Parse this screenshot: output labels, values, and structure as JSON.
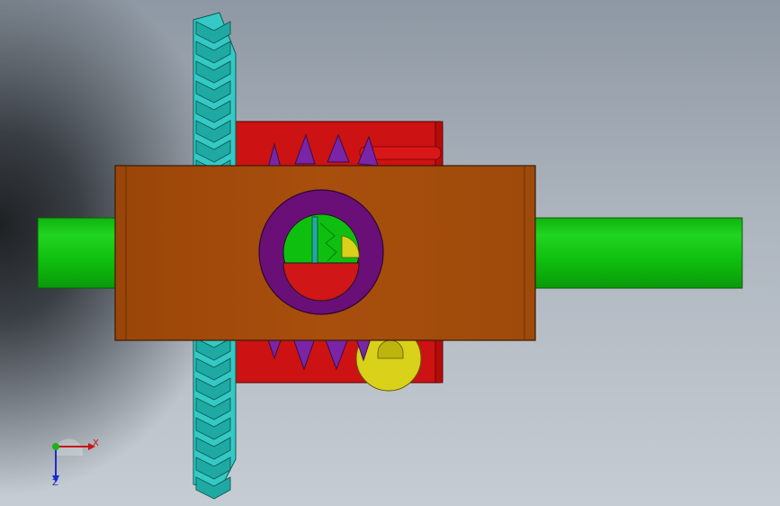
{
  "viewport": {
    "background_top": "#8e98a3",
    "background_bottom": "#c6ccd3"
  },
  "model": {
    "parts": [
      {
        "name": "shaft",
        "color": "#0fbf0f"
      },
      {
        "name": "bevel-gear",
        "color": "#34c9c4"
      },
      {
        "name": "gearbox-housing",
        "color": "#cc1212"
      },
      {
        "name": "front-plate",
        "color": "#a84f0d"
      },
      {
        "name": "spur-gear",
        "color": "#7a24a8"
      },
      {
        "name": "ring-hub",
        "color": "#6a0f78"
      },
      {
        "name": "cam",
        "color": "#d9d11a"
      }
    ]
  },
  "triad": {
    "x_label": "X",
    "z_label": "Z",
    "x_color": "#c81414",
    "y_color": "#18b418",
    "z_color": "#1a2ad0"
  }
}
